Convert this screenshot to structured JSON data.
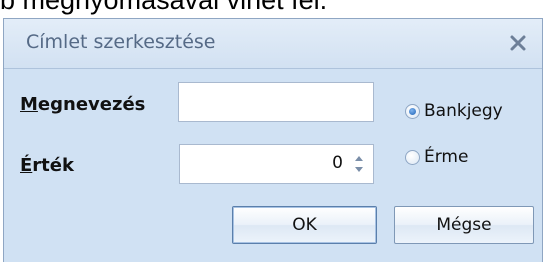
{
  "caption": {
    "text": "b megnyomásával vihet fel."
  },
  "dialog": {
    "title": "Címlet szerkesztése",
    "name_label_first": "M",
    "name_label_rest": "egnevezés",
    "name_value": "",
    "value_label_first": "É",
    "value_label_rest": "rték",
    "value_number": "0",
    "radio_options": [
      {
        "label": "Bankjegy",
        "checked": true
      },
      {
        "label": "Érme",
        "checked": false
      }
    ],
    "ok_label": "OK",
    "cancel_label": "Mégse"
  },
  "colors": {
    "dialog_bg": "#d0e1f3",
    "title_text": "#556a86",
    "border": "#8fa6c3"
  },
  "icons": {
    "close": "close-icon",
    "spinner": "spinner-arrows-icon"
  }
}
